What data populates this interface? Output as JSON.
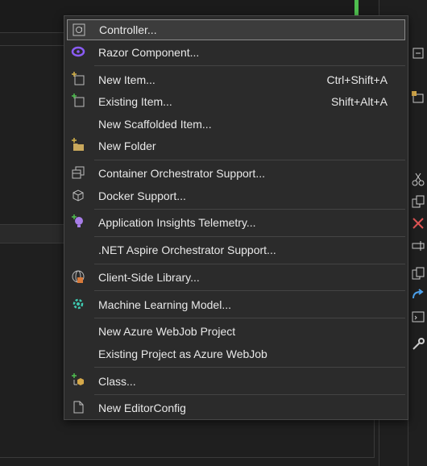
{
  "menu": {
    "items": [
      {
        "label": "Controller...",
        "shortcut": "",
        "icon": "controller-icon"
      },
      {
        "label": "Razor Component...",
        "shortcut": "",
        "icon": "blazor-icon"
      },
      {
        "label": "New Item...",
        "shortcut": "Ctrl+Shift+A",
        "icon": "new-item-icon"
      },
      {
        "label": "Existing Item...",
        "shortcut": "Shift+Alt+A",
        "icon": "existing-item-icon"
      },
      {
        "label": "New Scaffolded Item...",
        "shortcut": "",
        "icon": ""
      },
      {
        "label": "New Folder",
        "shortcut": "",
        "icon": "new-folder-icon"
      },
      {
        "label": "Container Orchestrator Support...",
        "shortcut": "",
        "icon": "container-orchestrator-icon"
      },
      {
        "label": "Docker Support...",
        "shortcut": "",
        "icon": "docker-icon"
      },
      {
        "label": "Application Insights Telemetry...",
        "shortcut": "",
        "icon": "app-insights-icon"
      },
      {
        "label": ".NET Aspire Orchestrator Support...",
        "shortcut": "",
        "icon": ""
      },
      {
        "label": "Client-Side Library...",
        "shortcut": "",
        "icon": "client-library-icon"
      },
      {
        "label": "Machine Learning Model...",
        "shortcut": "",
        "icon": "ml-model-icon"
      },
      {
        "label": "New Azure WebJob Project",
        "shortcut": "",
        "icon": ""
      },
      {
        "label": "Existing Project as Azure WebJob",
        "shortcut": "",
        "icon": ""
      },
      {
        "label": "Class...",
        "shortcut": "",
        "icon": "class-icon"
      },
      {
        "label": "New EditorConfig",
        "shortcut": "",
        "icon": "editorconfig-icon"
      }
    ],
    "selected_index": 0
  },
  "colors": {
    "menu_bg": "#2b2b2b",
    "selected_border": "#8a8a8a",
    "separator": "#444444",
    "accent_purple": "#8a5cf5",
    "accent_green": "#4fbf4f"
  }
}
